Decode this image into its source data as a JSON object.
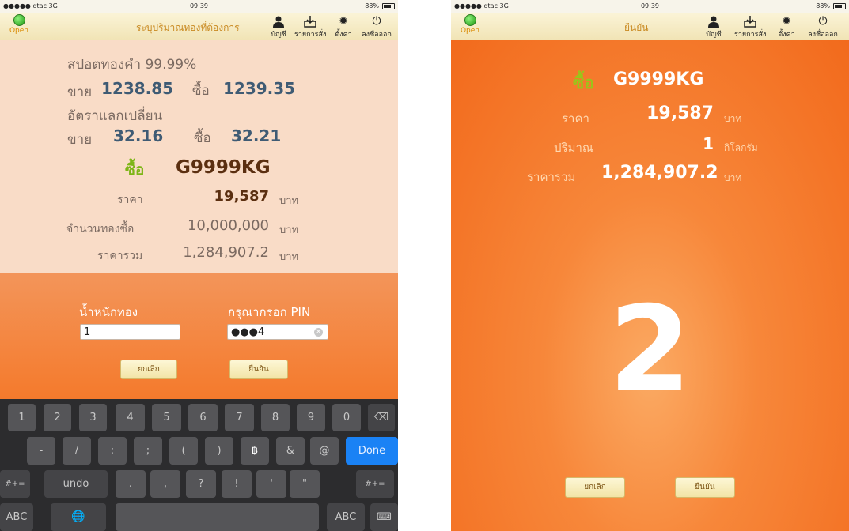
{
  "status": {
    "carrier": "●●●●● dtac  3G",
    "time": "09:39",
    "battery": "88%"
  },
  "nav": {
    "open_label": "Open",
    "account": "บัญชี",
    "orders": "รายการสั่ง",
    "settings": "ตั้งค่า",
    "logout": "ลงชื่อออก"
  },
  "left": {
    "title": "ระบุปริมาณทองที่ต้องการ",
    "spot_label": "สปอตทองคำ 99.99%",
    "spot_sell_label": "ขาย",
    "spot_sell": "1238.85",
    "spot_buy_label": "ซื้อ",
    "spot_buy": "1239.35",
    "fx_label": "อัตราแลกเปลี่ยน",
    "fx_sell_label": "ขาย",
    "fx_sell": "32.16",
    "fx_buy_label": "ซื้อ",
    "fx_buy": "32.21",
    "action": "ซื้อ",
    "product": "G9999KG",
    "price_label": "ราคา",
    "price": "19,587",
    "price_unit": "บาท",
    "amount_label": "จำนวนทองซื้อ",
    "amount": "10,000,000",
    "amount_unit": "บาท",
    "total_label": "ราคารวม",
    "total": "1,284,907.2",
    "total_unit": "บาท",
    "weight_label": "น้ำหนักทอง",
    "weight_value": "1",
    "pin_label": "กรุณากรอก PIN",
    "pin_value": "●●●4",
    "cancel": "ยกเลิก",
    "confirm": "ยืนยัน"
  },
  "keyboard": {
    "row1": [
      "1",
      "2",
      "3",
      "4",
      "5",
      "6",
      "7",
      "8",
      "9",
      "0"
    ],
    "backspace": "⌫",
    "row2": [
      "-",
      "/",
      ":",
      ";",
      "(",
      ")",
      "฿",
      "&",
      "@"
    ],
    "done": "Done",
    "row3_left": "#+=",
    "undo": "undo",
    "row3": [
      ".",
      ",",
      "?",
      "!",
      "'",
      "\""
    ],
    "row3_right": "#+=",
    "abc_left": "ABC",
    "globe": "🌐",
    "abc_right": "ABC",
    "kb_icon": "⌨"
  },
  "right": {
    "title": "ยืนยัน",
    "action": "ซื้อ",
    "product": "G9999KG",
    "price_label": "ราคา",
    "price": "19,587",
    "price_unit": "บาท",
    "qty_label": "ปริมาณ",
    "qty": "1",
    "qty_unit": "กิโลกรัม",
    "total_label": "ราคารวม",
    "total": "1,284,907.2",
    "total_unit": "บาท",
    "countdown": "2",
    "cancel": "ยกเลิก",
    "confirm": "ยืนยัน"
  },
  "colors": {
    "orange": "#f47a2c",
    "panel": "#f9dcc7",
    "gold": "#c98a22",
    "done": "#1a82f5"
  }
}
